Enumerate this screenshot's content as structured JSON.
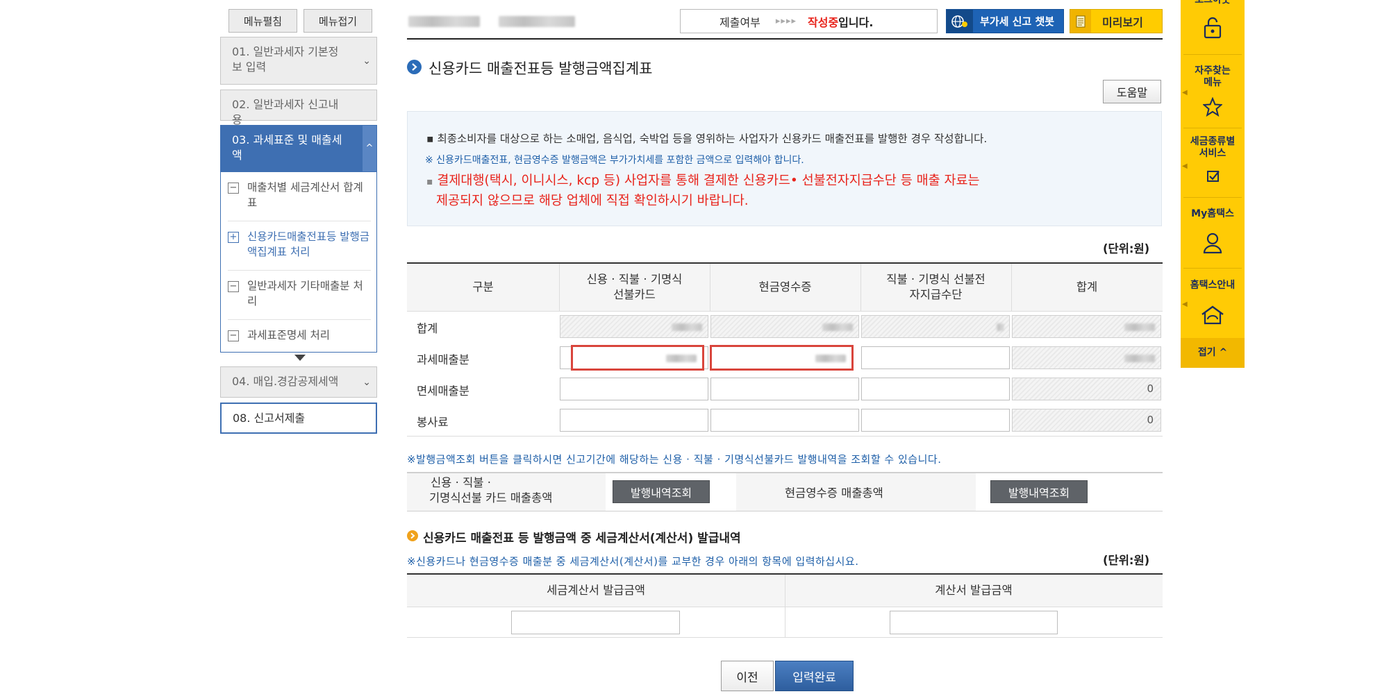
{
  "menu": {
    "expand_label": "메뉴펼침",
    "collapse_label": "메뉴접기",
    "steps": [
      {
        "label": "01. 일반과세자 기본정보 입력"
      },
      {
        "label": "02. 일반과세자 신고내용"
      },
      {
        "label": "03. 과세표준 및 매출세액"
      },
      {
        "label": "04. 매입.경감공제세액"
      },
      {
        "label": "08. 신고서제출"
      }
    ],
    "sub_items": [
      {
        "label": "매출처별 세금계산서 합계표",
        "box": "−"
      },
      {
        "label": "신용카드매출전표등 발행금액집계표 처리",
        "box": "+"
      },
      {
        "label": "일반과세자 기타매출분 처리",
        "box": "−"
      },
      {
        "label": "과세표준명세 처리",
        "box": "−"
      }
    ]
  },
  "header": {
    "status_label": "제출여부",
    "status_arrows": "▸▸▸▸",
    "status_red": "작성중",
    "status_suffix": "입니다.",
    "chatbot_label": "부가세 신고 챗봇",
    "preview_label": "미리보기"
  },
  "page": {
    "title": "신용카드 매출전표등 발행금액집계표",
    "help_label": "도움말",
    "info_line1": "최종소비자를 대상으로 하는 소매업, 음식업, 숙박업 등을 영위하는 사업자가 신용카드 매출전표를 발행한 경우 작성합니다.",
    "info_line2": "※ 신용카드매출전표, 현금영수증 발행금액은 부가가치세를 포함한 금액으로 입력해야 합니다.",
    "info_warn1": "결제대행(택시, 이니시스, kcp 등) 사업자를 통해 결제한 신용카드• 선불전자지급수단 등 매출 자료는",
    "info_warn2": "제공되지 않으므로 해당 업체에 직접 확인하시기 바랍니다.",
    "unit": "(단위:원)"
  },
  "table": {
    "headers": [
      "구분",
      "신용 · 직불 · 기명식 선불카드",
      "현금영수증",
      "직불 · 기명식 선불전자지급수단",
      "합계"
    ],
    "rows": [
      {
        "label": "합계",
        "values": [
          "",
          "",
          "",
          ""
        ]
      },
      {
        "label": "과세매출분",
        "values": [
          "",
          "",
          "",
          ""
        ]
      },
      {
        "label": "면세매출분",
        "values": [
          "",
          "",
          "",
          "0"
        ]
      },
      {
        "label": "봉사료",
        "values": [
          "",
          "",
          "",
          "0"
        ]
      }
    ]
  },
  "lookup": {
    "note": "※발행금액조회 버튼을 클릭하시면 신고기간에 해당하는 신용 · 직불 · 기명식선불카드 발행내역을 조회할 수 있습니다.",
    "card_label_1": "신용 · 직불 ·",
    "card_label_2": "기명식선불 카드 매출총액",
    "card_button": "발행내역조회",
    "cash_label": "현금영수증 매출총액",
    "cash_button": "발행내역조회"
  },
  "invoice": {
    "title": "신용카드 매출전표 등 발행금액 중 세금계산서(계산서) 발급내역",
    "note": "※신용카드나 현금영수증 매출분 중 세금계산서(계산서)를 교부한 경우 아래의 항목에 입력하십시요.",
    "unit": "(단위:원)",
    "col1": "세금계산서 발급금액",
    "col2": "계산서 발급금액",
    "col1_value": "",
    "col2_value": ""
  },
  "buttons": {
    "prev_label": "이전",
    "submit_label": "입력완료"
  },
  "quickbar": {
    "top_partial": "로그아웃",
    "fav_1": "자주찾는",
    "fav_2": "메뉴",
    "tax_1": "세금종류별",
    "tax_2": "서비스",
    "my": "My홈택스",
    "guide": "홈택스안내",
    "fold": "접기 ^"
  },
  "colors": {
    "accent_blue": "#3e6fb2",
    "chat_blue": "#1e63b5",
    "preview_yellow": "#ffcc00",
    "quickbar_yellow": "#ffcb05",
    "warning_red": "#e8231b",
    "highlight_red": "#d9453c"
  }
}
